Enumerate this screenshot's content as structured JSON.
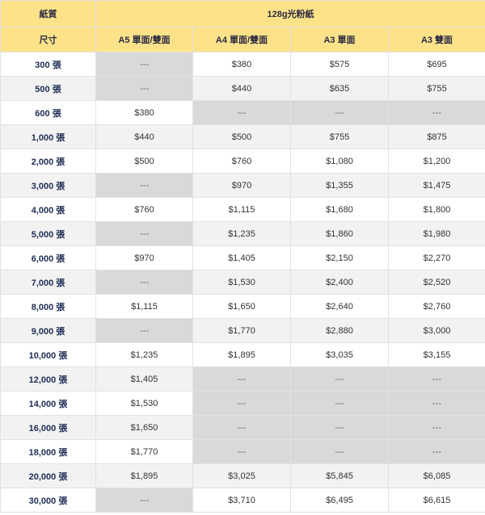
{
  "header": {
    "paper_label": "紙質",
    "paper_type": "128g光粉紙",
    "size_label": "尺寸",
    "columns": [
      "A5 單面/雙面",
      "A4 單面/雙面",
      "A3 單面",
      "A3 雙面"
    ]
  },
  "rows": [
    {
      "qty": "300 張",
      "prices": [
        "---",
        "$380",
        "$575",
        "$695"
      ]
    },
    {
      "qty": "500 張",
      "prices": [
        "---",
        "$440",
        "$635",
        "$755"
      ]
    },
    {
      "qty": "600 張",
      "prices": [
        "$380",
        "---",
        "---",
        "---"
      ]
    },
    {
      "qty": "1,000 張",
      "prices": [
        "$440",
        "$500",
        "$755",
        "$875"
      ]
    },
    {
      "qty": "2,000 張",
      "prices": [
        "$500",
        "$760",
        "$1,080",
        "$1,200"
      ]
    },
    {
      "qty": "3,000 張",
      "prices": [
        "---",
        "$970",
        "$1,355",
        "$1,475"
      ]
    },
    {
      "qty": "4,000 張",
      "prices": [
        "$760",
        "$1,115",
        "$1,680",
        "$1,800"
      ]
    },
    {
      "qty": "5,000 張",
      "prices": [
        "---",
        "$1,235",
        "$1,860",
        "$1,980"
      ]
    },
    {
      "qty": "6,000 張",
      "prices": [
        "$970",
        "$1,405",
        "$2,150",
        "$2,270"
      ]
    },
    {
      "qty": "7,000 張",
      "prices": [
        "---",
        "$1,530",
        "$2,400",
        "$2,520"
      ]
    },
    {
      "qty": "8,000 張",
      "prices": [
        "$1,115",
        "$1,650",
        "$2,640",
        "$2,760"
      ]
    },
    {
      "qty": "9,000 張",
      "prices": [
        "---",
        "$1,770",
        "$2,880",
        "$3,000"
      ]
    },
    {
      "qty": "10,000 張",
      "prices": [
        "$1,235",
        "$1,895",
        "$3,035",
        "$3,155"
      ]
    },
    {
      "qty": "12,000 張",
      "prices": [
        "$1,405",
        "---",
        "---",
        "---"
      ]
    },
    {
      "qty": "14,000 張",
      "prices": [
        "$1,530",
        "---",
        "---",
        "---"
      ]
    },
    {
      "qty": "16,000 張",
      "prices": [
        "$1,650",
        "---",
        "---",
        "---"
      ]
    },
    {
      "qty": "18,000 張",
      "prices": [
        "$1,770",
        "---",
        "---",
        "---"
      ]
    },
    {
      "qty": "20,000 張",
      "prices": [
        "$1,895",
        "$3,025",
        "$5,845",
        "$6,085"
      ]
    },
    {
      "qty": "30,000 張",
      "prices": [
        "---",
        "$3,710",
        "$6,495",
        "$6,615"
      ]
    }
  ],
  "colors": {
    "header_bg": "#fde28a",
    "unavailable_bg": "#d9d9d9",
    "stripe_bg": "#f2f2f2"
  }
}
